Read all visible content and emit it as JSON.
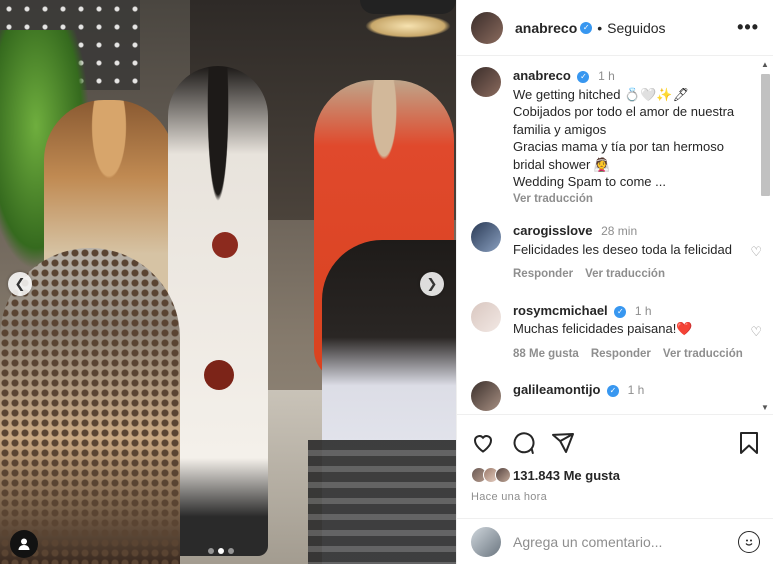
{
  "post": {
    "username": "anabreco",
    "follow_status": "Seguidos",
    "more": "•••",
    "carousel": {
      "current_index": 2,
      "total": 3
    }
  },
  "caption": {
    "username": "anabreco",
    "time": "1 h",
    "lines": [
      "We getting hitched 💍🤍✨🖊",
      "Cobijados por todo el amor de nuestra familia y amigos",
      "Gracias mama y tía por tan hermoso bridal shower 👰",
      "Wedding Spam to come ..."
    ],
    "translate": "Ver traducción"
  },
  "comments": [
    {
      "username": "carogisslove",
      "time": "28 min",
      "text": "Felicidades les deseo toda la felicidad",
      "likes": "",
      "reply": "Responder",
      "translate": "Ver traducción"
    },
    {
      "username": "rosymcmichael",
      "time": "1 h",
      "text": "Muchas felicidades paisana!❤️",
      "likes": "88 Me gusta",
      "reply": "Responder",
      "translate": "Ver traducción"
    },
    {
      "username": "galileamontijo",
      "time": "1 h",
      "text": "",
      "likes": "",
      "reply": "",
      "translate": ""
    }
  ],
  "stats": {
    "likes": "131.843 Me gusta",
    "posted": "Hace una hora"
  },
  "comment_box": {
    "placeholder": "Agrega un comentario..."
  },
  "colors": {
    "verified": "#3897f0",
    "muted": "#8e8e8e",
    "text": "#262626",
    "heart_red": "#ed4956"
  },
  "icons": {
    "like": "heart-icon",
    "comment": "comment-icon",
    "share": "share-icon",
    "save": "bookmark-icon",
    "emoji": "emoji-icon",
    "tag": "user-tag-icon"
  }
}
